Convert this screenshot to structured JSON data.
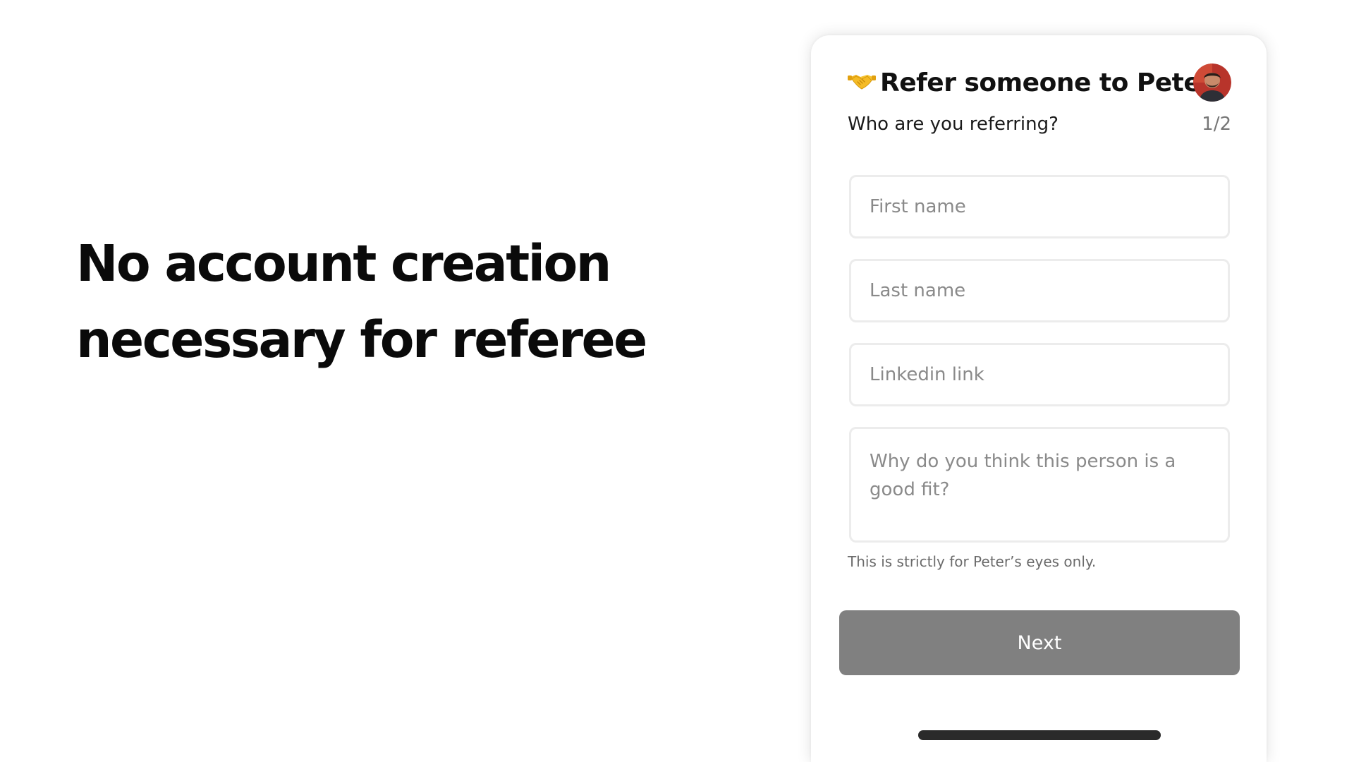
{
  "slide": {
    "headline_line1": "No account creation",
    "headline_line2": "necessary for referee"
  },
  "card": {
    "title": "Refer someone to Peter",
    "title_icon": "handshake-icon",
    "subtitle": "Who are you referring?",
    "step": "1/2",
    "fields": {
      "first_name_placeholder": "First name",
      "last_name_placeholder": "Last name",
      "linkedin_placeholder": "Linkedin link",
      "reason_placeholder": "Why do you think this person is a good fit?"
    },
    "helper_text": "This is strictly for Peter’s eyes only.",
    "next_label": "Next"
  },
  "colors": {
    "button_disabled": "#808080",
    "field_border": "#ececec",
    "text_primary": "#111111"
  }
}
